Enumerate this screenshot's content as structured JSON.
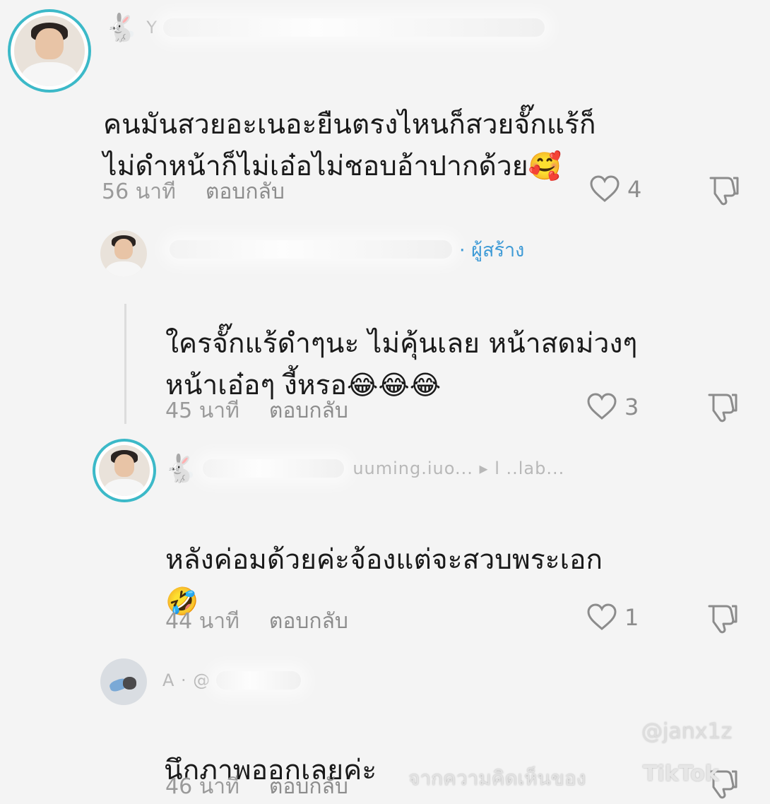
{
  "comments": [
    {
      "name_visible": "Y",
      "body": "คนมันสวยอะเนอะยืนตรงไหนก็สวยจั๊กแร้ก็\nไม่ดำหน้าก็ไม่เอ๋อไม่ชอบอ้าปากด้วย",
      "emoji": "🥰",
      "time": "56 นาที",
      "reply_label": "ตอบกลับ",
      "likes": "4"
    },
    {
      "creator_badge": "· ผู้สร้าง",
      "body": "ใครจั๊กแร้ดำๆนะ ไม่คุ้นเลย หน้าสดม่วงๆ\nหน้าเอ๋อๆ งี้หรอ",
      "emoji": "😂😂😂",
      "time": "45 นาที",
      "reply_label": "ตอบกลับ",
      "likes": "3"
    },
    {
      "name_visible": "uuming.iuo... ▸ l  ..lab...",
      "body": "หลังค่อมด้วยค่ะจ้องแต่จะสวบพระเอก",
      "emoji": "🤣",
      "time": "44 นาที",
      "reply_label": "ตอบกลับ",
      "likes": "1"
    },
    {
      "name_visible": "A · @",
      "body": "นึกภาพออกเลยค่ะ",
      "time": "46 นาที",
      "reply_label": "ตอบกลับ"
    }
  ],
  "watermark": {
    "handle": "@janx1z",
    "caption": "จากความคิดเห็นของ",
    "logo": "TikTok"
  },
  "icons": {
    "like": "heart-outline-icon",
    "dislike": "thumbs-down-icon",
    "rabbit": "rabbit-icon"
  }
}
